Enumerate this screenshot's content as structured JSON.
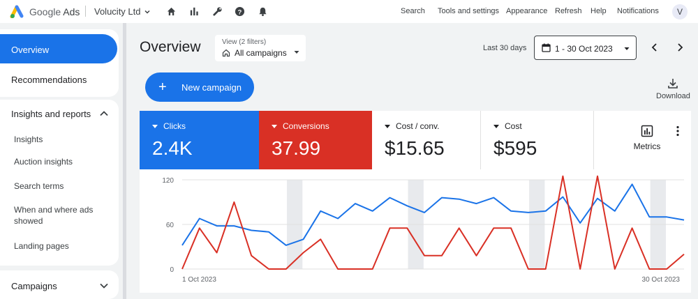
{
  "header": {
    "brand_primary": "Google",
    "brand_product": "Ads",
    "account_name": "Volucity Ltd",
    "icons": [
      "home-icon",
      "reports-icon",
      "tools-icon",
      "help-icon",
      "notifications-icon"
    ],
    "links": {
      "search": "Search",
      "tools": "Tools and settings",
      "appearance": "Appearance",
      "refresh": "Refresh",
      "help": "Help",
      "notifications": "Notifications"
    },
    "avatar_initial": "V"
  },
  "sidebar": {
    "overview": "Overview",
    "recommendations": "Recommendations",
    "insights_section": "Insights and reports",
    "insights_items": [
      "Insights",
      "Auction insights",
      "Search terms",
      "When and where ads showed",
      "Landing pages"
    ],
    "campaigns": "Campaigns"
  },
  "main": {
    "title": "Overview",
    "view_filter": {
      "label": "View (2 filters)",
      "value": "All campaigns"
    },
    "date_range_label": "Last 30 days",
    "date_range_value": "1 - 30 Oct 2023",
    "new_campaign": "New campaign",
    "download": "Download",
    "metrics_button": "Metrics"
  },
  "metrics": [
    {
      "name": "Clicks",
      "value": "2.4K"
    },
    {
      "name": "Conversions",
      "value": "37.99"
    },
    {
      "name": "Cost / conv.",
      "value": "$15.65"
    },
    {
      "name": "Cost",
      "value": "$595"
    }
  ],
  "colors": {
    "primary_blue": "#1a73e8",
    "conversions_red": "#d93025",
    "background": "#f1f3f4"
  },
  "chart_data": {
    "type": "line",
    "x": [
      "1 Oct 2023",
      "2 Oct 2023",
      "3 Oct 2023",
      "4 Oct 2023",
      "5 Oct 2023",
      "6 Oct 2023",
      "7 Oct 2023",
      "8 Oct 2023",
      "9 Oct 2023",
      "10 Oct 2023",
      "11 Oct 2023",
      "12 Oct 2023",
      "13 Oct 2023",
      "14 Oct 2023",
      "15 Oct 2023",
      "16 Oct 2023",
      "17 Oct 2023",
      "18 Oct 2023",
      "19 Oct 2023",
      "20 Oct 2023",
      "21 Oct 2023",
      "22 Oct 2023",
      "23 Oct 2023",
      "24 Oct 2023",
      "25 Oct 2023",
      "26 Oct 2023",
      "27 Oct 2023",
      "28 Oct 2023",
      "29 Oct 2023",
      "30 Oct 2023"
    ],
    "x_tick_labels": [
      "1 Oct 2023",
      "30 Oct 2023"
    ],
    "y_ticks": [
      0,
      60,
      120
    ],
    "ylim": [
      0,
      120
    ],
    "weekend_bands": [
      [
        "7 Oct 2023",
        "8 Oct 2023"
      ],
      [
        "14 Oct 2023",
        "15 Oct 2023"
      ],
      [
        "21 Oct 2023",
        "22 Oct 2023"
      ],
      [
        "28 Oct 2023",
        "29 Oct 2023"
      ]
    ],
    "grid": "horizontal",
    "series": [
      {
        "color": "#1a73e8",
        "values": [
          32,
          68,
          58,
          58,
          52,
          50,
          32,
          40,
          78,
          68,
          88,
          78,
          96,
          85,
          76,
          96,
          94,
          88,
          96,
          78,
          76,
          78,
          97,
          62,
          95,
          78,
          114,
          70,
          70,
          66
        ]
      },
      {
        "color": "#d93025",
        "values": [
          0,
          55,
          22,
          90,
          18,
          0,
          0,
          22,
          40,
          0,
          0,
          0,
          55,
          55,
          18,
          18,
          55,
          18,
          55,
          55,
          0,
          0,
          125,
          0,
          125,
          0,
          55,
          0,
          0,
          20
        ]
      }
    ]
  }
}
